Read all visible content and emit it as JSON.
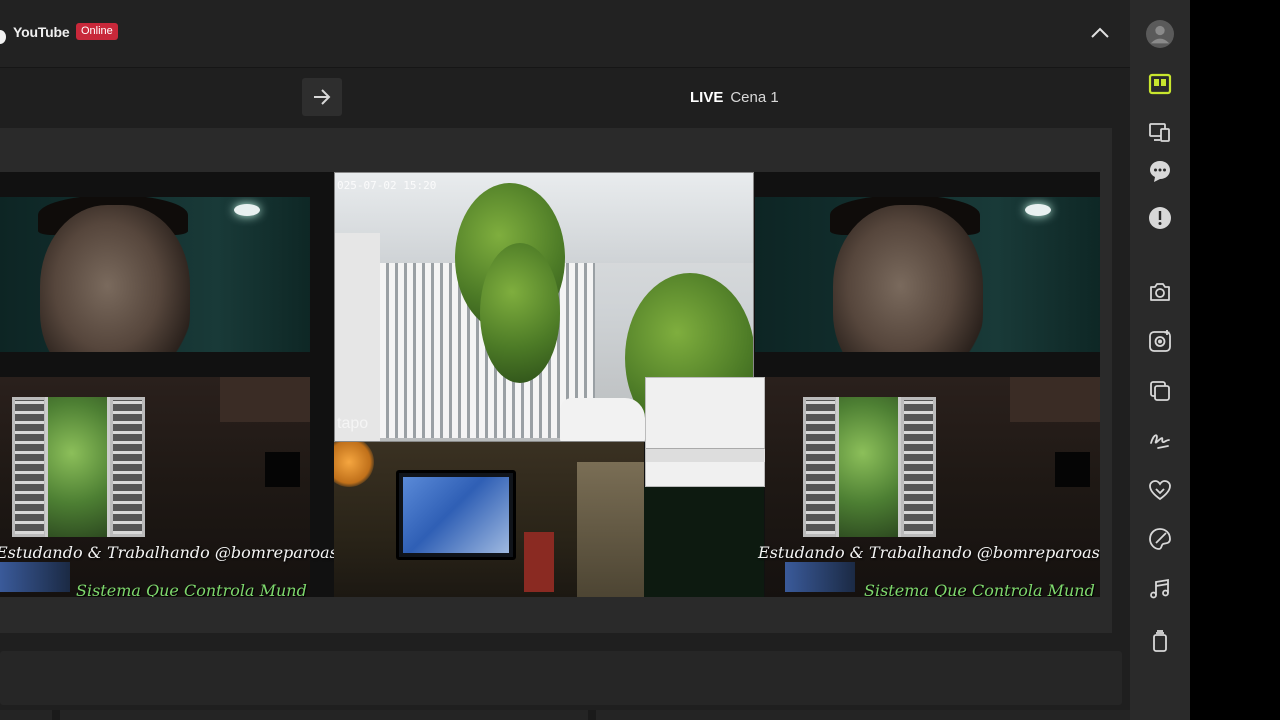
{
  "header": {
    "platform": "YouTube",
    "status": "Online"
  },
  "scene": {
    "live_label": "LIVE",
    "scene_name": "Cena 1"
  },
  "preview": {
    "caption_line1": "Estudando & Trabalhando @bomreparoassistenc",
    "caption_line2": "Sistema Que Controla Mund",
    "camera_timestamp": "025-07-02 15:20",
    "camera_brand": "tapo"
  },
  "sidebar": {
    "items": [
      {
        "icon": "avatar-icon"
      },
      {
        "icon": "scene-layout-icon",
        "active": true
      },
      {
        "icon": "devices-icon"
      },
      {
        "icon": "chat-icon"
      },
      {
        "icon": "alert-icon"
      },
      {
        "icon": "camera-icon"
      },
      {
        "icon": "record-icon"
      },
      {
        "icon": "layers-icon"
      },
      {
        "icon": "signature-icon"
      },
      {
        "icon": "heart-icon"
      },
      {
        "icon": "palette-icon"
      },
      {
        "icon": "music-icon"
      },
      {
        "icon": "remote-icon"
      }
    ]
  },
  "colors": {
    "accent": "#c8e62e",
    "status_badge": "#c8283a",
    "caption_green": "#7ed86d"
  }
}
